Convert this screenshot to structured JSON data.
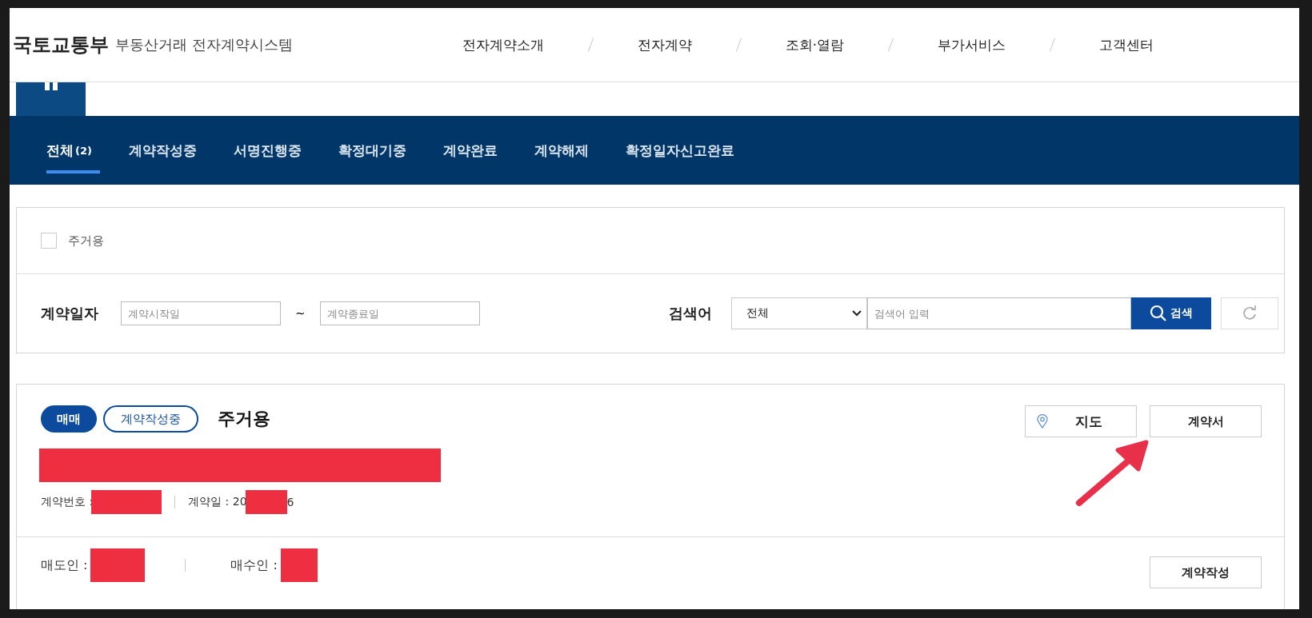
{
  "header": {
    "logo": "국토교통부",
    "system_name": "부동산거래 전자계약시스템",
    "menu": [
      "전자계약소개",
      "전자계약",
      "조회·열람",
      "부가서비스",
      "고객센터"
    ]
  },
  "status_tabs": [
    {
      "label": "전체",
      "count": "(2)",
      "selected": true
    },
    {
      "label": "계약작성중",
      "selected": false
    },
    {
      "label": "서명진행중",
      "selected": false
    },
    {
      "label": "확정대기중",
      "selected": false
    },
    {
      "label": "계약완료",
      "selected": false
    },
    {
      "label": "계약해제",
      "selected": false
    },
    {
      "label": "확정일자신고완료",
      "selected": false
    }
  ],
  "filter": {
    "residential_checkbox": {
      "label": "주거용",
      "checked": false
    },
    "date_label": "계약일자",
    "start_placeholder": "계약시작일",
    "separator": "~",
    "end_placeholder": "계약종료일",
    "search_label": "검색어",
    "search_scope": "전체",
    "search_placeholder": "검색어 입력",
    "search_button": "검색"
  },
  "contracts": [
    {
      "trade_type": "매매",
      "status": "계약작성중",
      "usage": "주거용",
      "address_redacted": true,
      "details": [
        {
          "label": "계약번호 :",
          "redacted": true
        },
        {
          "label": "계약일 : 20",
          "redacted": true,
          "suffix": "6"
        }
      ],
      "map_button": "지도",
      "contract_button": "계약서",
      "write_button": "계약작성",
      "parties": [
        {
          "label": "매도인 :",
          "redacted": true
        },
        {
          "label": "매수인 :",
          "redacted": true
        }
      ]
    }
  ]
}
